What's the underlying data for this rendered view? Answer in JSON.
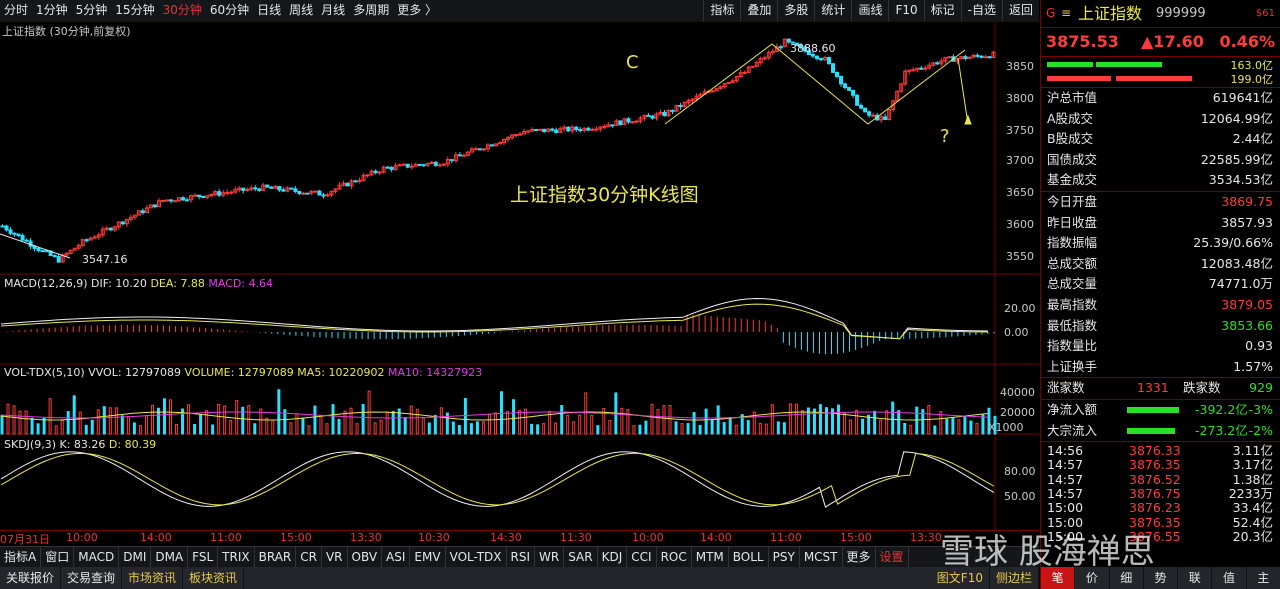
{
  "toolbar": {
    "periods": [
      "分时",
      "1分钟",
      "5分钟",
      "15分钟",
      "30分钟",
      "60分钟",
      "日线",
      "周线",
      "月线",
      "多周期",
      "更多 〉"
    ],
    "active_period": "30分钟",
    "right_items": [
      "指标",
      "叠加",
      "多股",
      "统计",
      "画线",
      "F10",
      "标记",
      "-自选",
      "返回"
    ]
  },
  "chart": {
    "title": "上证指数 (30分钟,前复权)",
    "center_label": "上证指数30分钟K线图",
    "label_c": "C",
    "label_q": "?",
    "max_marker": "3888.60",
    "min_marker": "3547.16",
    "price_axis": [
      "3850",
      "3800",
      "3750",
      "3700",
      "3650",
      "3600",
      "3550"
    ],
    "macd_title": {
      "name": "MACD(12,26,9)",
      "dif": "DIF: 10.20",
      "dea": "DEA: 7.88",
      "macd": "MACD: 4.64"
    },
    "macd_axis": [
      "20.00",
      "0.00"
    ],
    "vol_title": {
      "name": "VOL-TDX(5,10)",
      "vvol": "VVOL: 12797089",
      "volume": "VOLUME: 12797089",
      "ma5": "MA5: 10220902",
      "ma10": "MA10: 14327923"
    },
    "vol_axis": [
      "40000",
      "20000"
    ],
    "vol_unit": "X1000",
    "skdj_title": {
      "name": "SKDJ(9,3)",
      "k": "K: 83.26",
      "d": "D: 80.39"
    },
    "skdj_axis": [
      "80.00",
      "50.00"
    ],
    "time_labels": [
      "07月31日",
      "10:00",
      "14:00",
      "11:00",
      "15:00",
      "13:30",
      "10:30",
      "14:30",
      "11:30",
      "10:00",
      "14:00",
      "11:00",
      "15:00",
      "13:30"
    ]
  },
  "indicator_tabs": [
    "指标A",
    "窗口",
    "MACD",
    "DMI",
    "DMA",
    "FSL",
    "TRIX",
    "BRAR",
    "CR",
    "VR",
    "OBV",
    "ASI",
    "EMV",
    "VOL-TDX",
    "RSI",
    "WR",
    "SAR",
    "KDJ",
    "CCI",
    "ROC",
    "MTM",
    "BOLL",
    "PSY",
    "MCST",
    "更多",
    "设置"
  ],
  "bottom_bar": {
    "left": [
      "关联报价",
      "交易查询",
      "市场资讯",
      "板块资讯"
    ],
    "right": [
      "图文F10",
      "侧边栏"
    ]
  },
  "side": {
    "marker": "G",
    "menu": "≡",
    "name": "上证指数",
    "code": "999999",
    "tag": "$61",
    "price": "3875.53",
    "change": "▲17.60",
    "pct": "0.46%",
    "buy_vol": "163.0亿",
    "sell_vol": "199.0亿",
    "stats1": [
      {
        "k": "沪总市值",
        "v": "619641亿",
        "c": "white"
      },
      {
        "k": "A股成交",
        "v": "12064.99亿",
        "c": "white"
      },
      {
        "k": "B股成交",
        "v": "2.44亿",
        "c": "white"
      },
      {
        "k": "国债成交",
        "v": "22585.99亿",
        "c": "white"
      },
      {
        "k": "基金成交",
        "v": "3534.53亿",
        "c": "white"
      }
    ],
    "stats2": [
      {
        "k": "今日开盘",
        "v": "3869.75",
        "c": "red"
      },
      {
        "k": "昨日收盘",
        "v": "3857.93",
        "c": "white"
      },
      {
        "k": "指数振幅",
        "v": "25.39/0.66%",
        "c": "white"
      },
      {
        "k": "总成交额",
        "v": "12083.48亿",
        "c": "white"
      },
      {
        "k": "总成交量",
        "v": "74771.0万",
        "c": "white"
      },
      {
        "k": "最高指数",
        "v": "3879.05",
        "c": "red"
      },
      {
        "k": "最低指数",
        "v": "3853.66",
        "c": "green"
      },
      {
        "k": "指数量比",
        "v": "0.93",
        "c": "white"
      },
      {
        "k": "上证换手",
        "v": "1.57%",
        "c": "white"
      }
    ],
    "rise_label": "涨家数",
    "rise_count": "1331",
    "fall_label": "跌家数",
    "fall_count": "929",
    "flows": [
      {
        "k": "净流入额",
        "v": "-392.2亿",
        "p": "-3%"
      },
      {
        "k": "大宗流入",
        "v": "-273.2亿",
        "p": "-2%"
      }
    ],
    "ticks": [
      {
        "t": "14:56",
        "p": "3876.33",
        "v": "3.11亿"
      },
      {
        "t": "14:57",
        "p": "3876.35",
        "v": "3.17亿"
      },
      {
        "t": "14:57",
        "p": "3876.52",
        "v": "1.38亿"
      },
      {
        "t": "14:57",
        "p": "3876.75",
        "v": "2233万"
      },
      {
        "t": "15:00",
        "p": "3876.23",
        "v": "33.4亿"
      },
      {
        "t": "15:00",
        "p": "3876.35",
        "v": "52.4亿"
      },
      {
        "t": "15:00",
        "p": "3876.55",
        "v": "20.3亿"
      }
    ],
    "footer": [
      "笔",
      "价",
      "细",
      "势",
      "联",
      "值",
      "主"
    ],
    "footer_selected": "笔"
  },
  "watermark": "雪球  股海禅思",
  "colors": {
    "up": "#ff3b3b",
    "down": "#28e0ff",
    "fall": "#28e028",
    "line_yellow": "#e8e84a",
    "line_white": "#f0f0f0",
    "line_magenta": "#e23be2"
  }
}
